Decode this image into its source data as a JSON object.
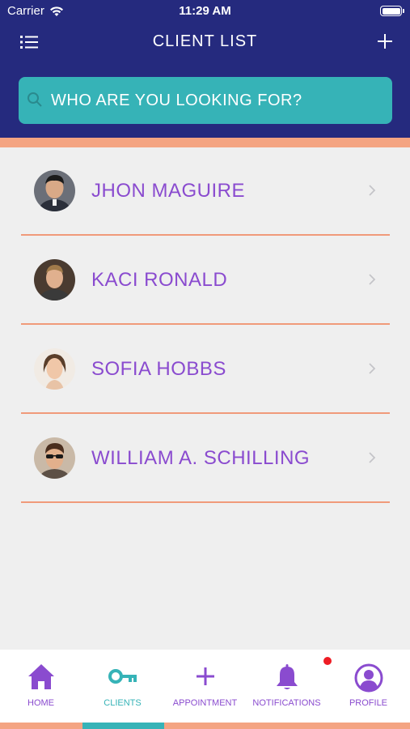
{
  "status_bar": {
    "carrier": "Carrier",
    "time": "11:29 AM"
  },
  "header": {
    "title": "CLIENT LIST"
  },
  "search": {
    "placeholder": "WHO ARE YOU LOOKING FOR?"
  },
  "clients": [
    {
      "name": "JHON MAGUIRE"
    },
    {
      "name": "KACI RONALD"
    },
    {
      "name": "SOFIA HOBBS"
    },
    {
      "name": "WILLIAM A. SCHILLING"
    }
  ],
  "tabs": [
    {
      "label": "HOME",
      "icon": "home-icon"
    },
    {
      "label": "CLIENTS",
      "icon": "key-icon"
    },
    {
      "label": "APPOINTMENT",
      "icon": "plus-icon"
    },
    {
      "label": "NOTIFICATIONS",
      "icon": "bell-icon"
    },
    {
      "label": "PROFILE",
      "icon": "user-circle-icon"
    }
  ],
  "colors": {
    "header": "#252a7e",
    "accent": "#f4a482",
    "teal": "#36b3b7",
    "purple": "#8a4bcf",
    "badge": "#ee1c24"
  }
}
